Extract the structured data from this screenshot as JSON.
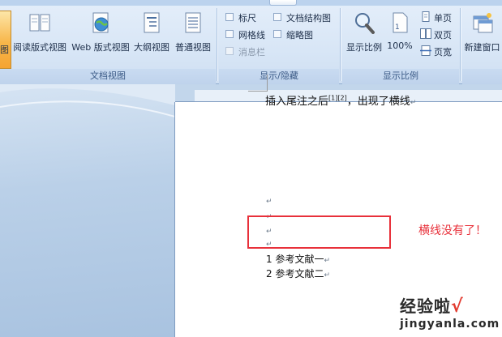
{
  "ribbon": {
    "groups": {
      "doc_views": {
        "label": "文档视图",
        "buttons": {
          "full_read": "阅读版式视图",
          "web": "Web 版式视图",
          "outline": "大纲视图",
          "draft": "普通视图"
        },
        "partial_active_label": "图"
      },
      "show_hide": {
        "label": "显示/隐藏",
        "items": {
          "ruler": "标尺",
          "doc_map": "文档结构图",
          "gridlines": "网格线",
          "thumbnails": "缩略图",
          "message_bar": "消息栏"
        }
      },
      "zoom": {
        "label": "显示比例",
        "buttons": {
          "zoom": "显示比例",
          "hundred": "100%",
          "one_page": "单页",
          "two_pages": "双页",
          "page_width": "页宽"
        }
      },
      "window": {
        "buttons": {
          "new_window": "新建窗口"
        }
      }
    }
  },
  "document": {
    "main_text": "插入尾注之后",
    "sup1": "[1]",
    "sup2": "[2]",
    "main_text_tail": "，出现了横线",
    "para_mark": "↵",
    "refs": [
      "1 参考文献一",
      "2 参考文献二"
    ]
  },
  "annotation": {
    "text": "横线没有了！",
    "color": "#e8303a"
  },
  "watermark": {
    "main": "经验啦",
    "check": "√",
    "sub": "jingyanla.com"
  }
}
